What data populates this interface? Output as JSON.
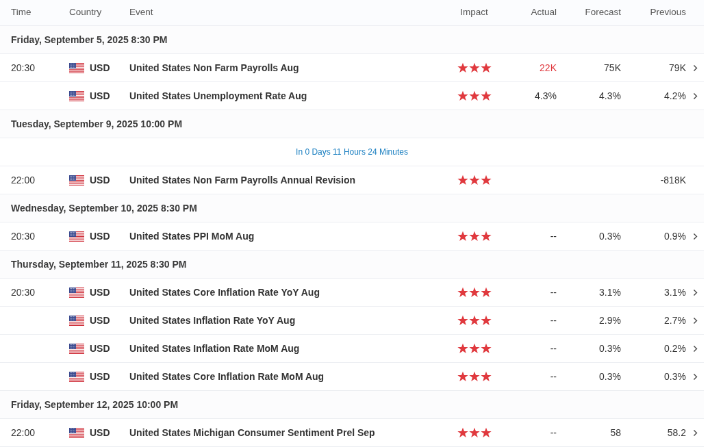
{
  "columns": {
    "time": "Time",
    "country": "Country",
    "event": "Event",
    "impact": "Impact",
    "actual": "Actual",
    "forecast": "Forecast",
    "previous": "Previous"
  },
  "groups": [
    {
      "date": "Friday, September 5, 2025 8:30 PM",
      "events": [
        {
          "time": "20:30",
          "currency": "USD",
          "event": "United States Non Farm Payrolls Aug",
          "stars": 3,
          "actual": "22K",
          "actual_negative": true,
          "forecast": "75K",
          "previous": "79K",
          "expandable": true
        },
        {
          "currency": "USD",
          "event": "United States Unemployment Rate Aug",
          "stars": 3,
          "actual": "4.3%",
          "actual_negative": false,
          "forecast": "4.3%",
          "previous": "4.2%",
          "expandable": true
        }
      ]
    },
    {
      "date": "Tuesday, September 9, 2025 10:00 PM",
      "countdown": "In 0 Days 11 Hours 24 Minutes",
      "events": [
        {
          "time": "22:00",
          "currency": "USD",
          "event": "United States Non Farm Payrolls Annual Revision",
          "stars": 3,
          "previous": "-818K",
          "expandable": false
        }
      ]
    },
    {
      "date": "Wednesday, September 10, 2025 8:30 PM",
      "events": [
        {
          "time": "20:30",
          "currency": "USD",
          "event": "United States PPI MoM Aug",
          "stars": 3,
          "actual": "--",
          "actual_negative": false,
          "forecast": "0.3%",
          "previous": "0.9%",
          "expandable": true
        }
      ]
    },
    {
      "date": "Thursday, September 11, 2025 8:30 PM",
      "events": [
        {
          "time": "20:30",
          "currency": "USD",
          "event": "United States Core Inflation Rate YoY Aug",
          "stars": 3,
          "actual": "--",
          "actual_negative": false,
          "forecast": "3.1%",
          "previous": "3.1%",
          "expandable": true
        },
        {
          "currency": "USD",
          "event": "United States Inflation Rate YoY Aug",
          "stars": 3,
          "actual": "--",
          "actual_negative": false,
          "forecast": "2.9%",
          "previous": "2.7%",
          "expandable": true
        },
        {
          "currency": "USD",
          "event": "United States Inflation Rate MoM Aug",
          "stars": 3,
          "actual": "--",
          "actual_negative": false,
          "forecast": "0.3%",
          "previous": "0.2%",
          "expandable": true
        },
        {
          "currency": "USD",
          "event": "United States Core Inflation Rate MoM Aug",
          "stars": 3,
          "actual": "--",
          "actual_negative": false,
          "forecast": "0.3%",
          "previous": "0.3%",
          "expandable": true
        }
      ]
    },
    {
      "date": "Friday, September 12, 2025 10:00 PM",
      "events": [
        {
          "time": "22:00",
          "currency": "USD",
          "event": "United States Michigan Consumer Sentiment Prel Sep",
          "stars": 3,
          "actual": "--",
          "actual_negative": false,
          "forecast": "58",
          "previous": "58.2",
          "expandable": true
        }
      ]
    }
  ]
}
